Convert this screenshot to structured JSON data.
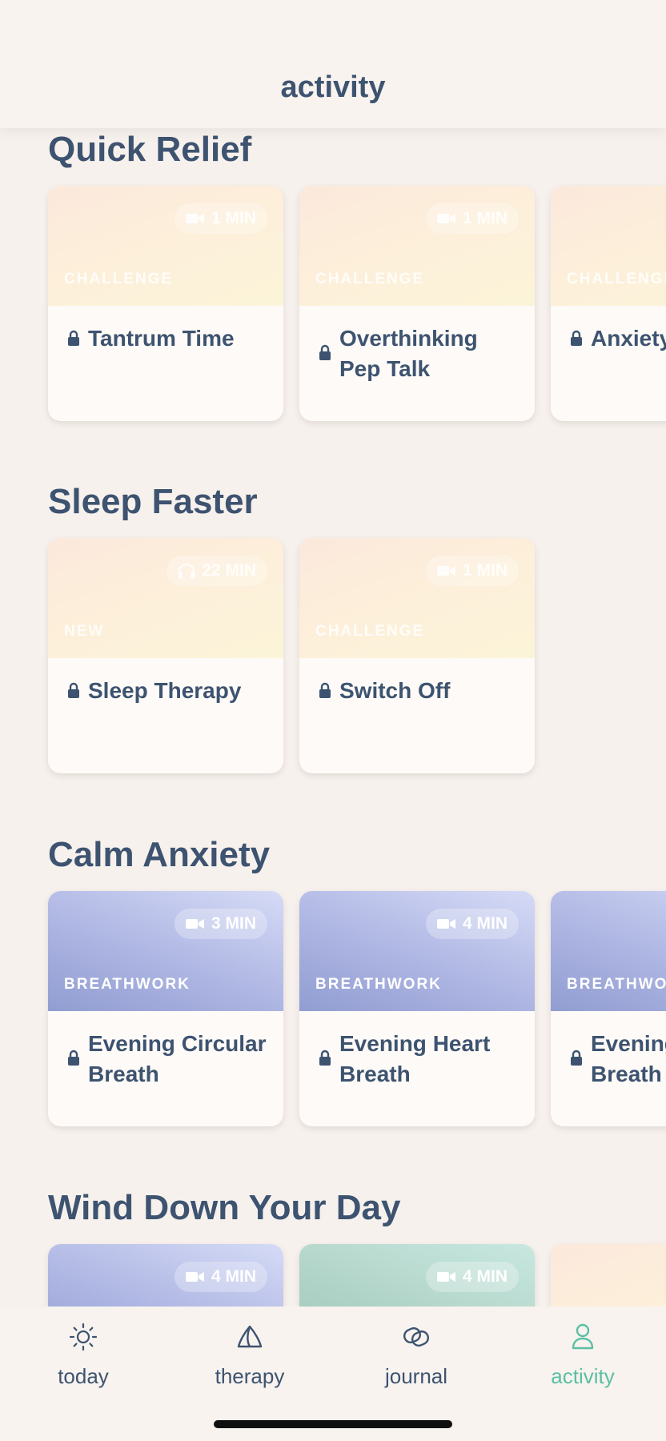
{
  "header": {
    "title": "activity"
  },
  "colors": {
    "background": "#f7f1ed",
    "text": "#3d5370",
    "accent": "#5bbfa3",
    "warm_card": "#fdf0da",
    "blue_card": "#aeb6e3",
    "green_card": "#afd2c6"
  },
  "sections": [
    {
      "title": "Quick Relief",
      "cards": [
        {
          "duration": "1 MIN",
          "media_icon": "video-camera-icon",
          "category": "CHALLENGE",
          "title": "Tantrum Time",
          "locked": true,
          "theme": "warm"
        },
        {
          "duration": "1 MIN",
          "media_icon": "video-camera-icon",
          "category": "CHALLENGE",
          "title": "Overthinking Pep Talk",
          "locked": true,
          "theme": "warm"
        },
        {
          "duration": "",
          "media_icon": "",
          "category": "CHALLENGE",
          "title": "Anxiety",
          "locked": true,
          "theme": "warm"
        }
      ]
    },
    {
      "title": "Sleep Faster",
      "cards": [
        {
          "duration": "22 MIN",
          "media_icon": "headphones-icon",
          "category": "NEW",
          "title": "Sleep Therapy",
          "locked": true,
          "theme": "warm"
        },
        {
          "duration": "1 MIN",
          "media_icon": "video-camera-icon",
          "category": "CHALLENGE",
          "title": "Switch Off",
          "locked": true,
          "theme": "warm"
        }
      ]
    },
    {
      "title": "Calm Anxiety",
      "cards": [
        {
          "duration": "3 MIN",
          "media_icon": "video-camera-icon",
          "category": "BREATHWORK",
          "title": "Evening Circular Breath",
          "locked": true,
          "theme": "blue"
        },
        {
          "duration": "4 MIN",
          "media_icon": "video-camera-icon",
          "category": "BREATHWORK",
          "title": "Evening Heart Breath",
          "locked": true,
          "theme": "blue"
        },
        {
          "duration": "",
          "media_icon": "",
          "category": "BREATHWOR",
          "title": "Evening Breath",
          "locked": true,
          "theme": "blue"
        }
      ]
    },
    {
      "title": "Wind Down Your Day",
      "cards": [
        {
          "duration": "4 MIN",
          "media_icon": "video-camera-icon",
          "category": "",
          "title": "",
          "locked": false,
          "theme": "blue"
        },
        {
          "duration": "4 MIN",
          "media_icon": "video-camera-icon",
          "category": "",
          "title": "",
          "locked": false,
          "theme": "green"
        },
        {
          "duration": "",
          "media_icon": "",
          "category": "",
          "title": "",
          "locked": false,
          "theme": "warm"
        }
      ]
    }
  ],
  "tabbar": {
    "items": [
      {
        "label": "today",
        "icon": "sun-icon",
        "active": false
      },
      {
        "label": "therapy",
        "icon": "triangle-leaf-icon",
        "active": false
      },
      {
        "label": "journal",
        "icon": "journal-loop-icon",
        "active": false
      },
      {
        "label": "activity",
        "icon": "person-icon",
        "active": true
      }
    ]
  }
}
